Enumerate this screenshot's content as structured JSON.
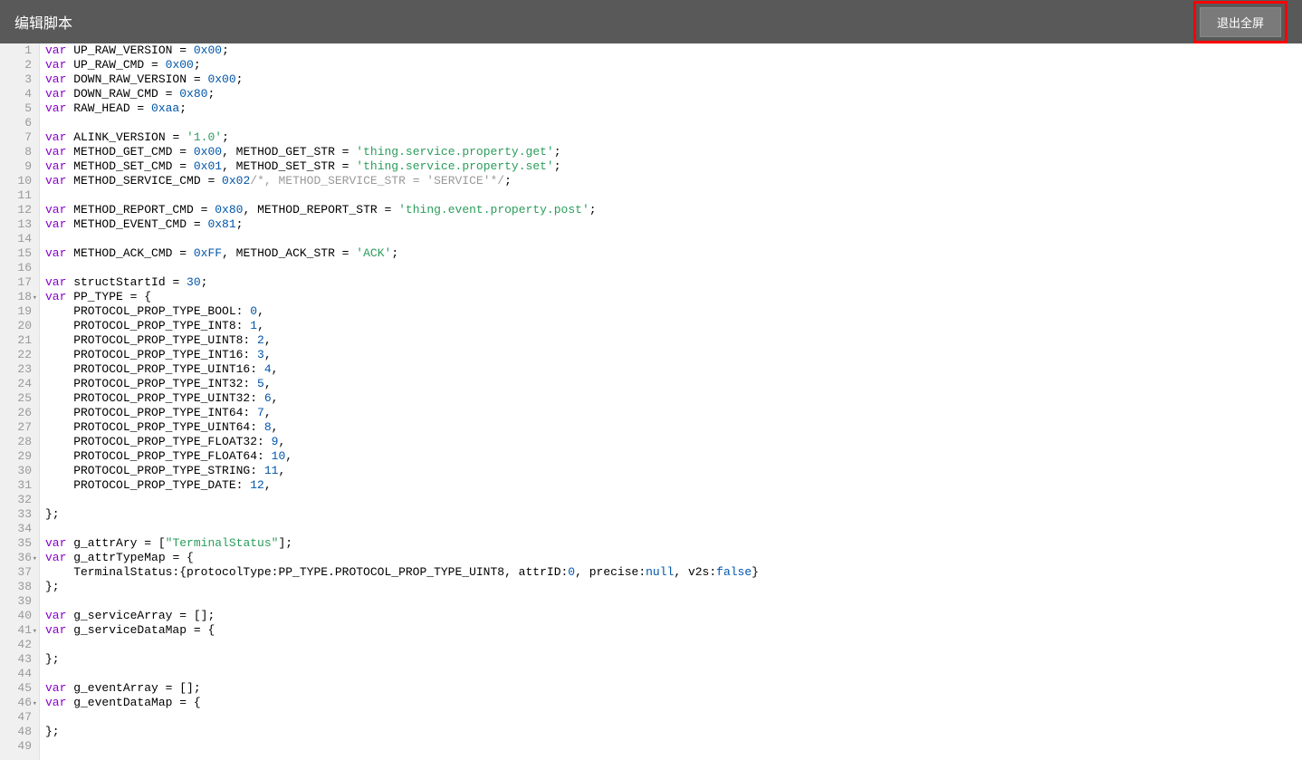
{
  "header": {
    "title": "编辑脚本",
    "exit_button": "退出全屏"
  },
  "editor": {
    "first_line": 1,
    "fold_lines": [
      18,
      36,
      41,
      46
    ],
    "lines": [
      {
        "n": 1,
        "tokens": [
          [
            "kw",
            "var"
          ],
          [
            "ident",
            " UP_RAW_VERSION "
          ],
          [
            "punct",
            "= "
          ],
          [
            "num",
            "0x00"
          ],
          [
            "punct",
            ";"
          ]
        ]
      },
      {
        "n": 2,
        "tokens": [
          [
            "kw",
            "var"
          ],
          [
            "ident",
            " UP_RAW_CMD "
          ],
          [
            "punct",
            "= "
          ],
          [
            "num",
            "0x00"
          ],
          [
            "punct",
            ";"
          ]
        ]
      },
      {
        "n": 3,
        "tokens": [
          [
            "kw",
            "var"
          ],
          [
            "ident",
            " DOWN_RAW_VERSION "
          ],
          [
            "punct",
            "= "
          ],
          [
            "num",
            "0x00"
          ],
          [
            "punct",
            ";"
          ]
        ]
      },
      {
        "n": 4,
        "tokens": [
          [
            "kw",
            "var"
          ],
          [
            "ident",
            " DOWN_RAW_CMD "
          ],
          [
            "punct",
            "= "
          ],
          [
            "num",
            "0x80"
          ],
          [
            "punct",
            ";"
          ]
        ]
      },
      {
        "n": 5,
        "tokens": [
          [
            "kw",
            "var"
          ],
          [
            "ident",
            " RAW_HEAD "
          ],
          [
            "punct",
            "= "
          ],
          [
            "num",
            "0xaa"
          ],
          [
            "punct",
            ";"
          ]
        ]
      },
      {
        "n": 6,
        "tokens": []
      },
      {
        "n": 7,
        "tokens": [
          [
            "kw",
            "var"
          ],
          [
            "ident",
            " ALINK_VERSION "
          ],
          [
            "punct",
            "= "
          ],
          [
            "str",
            "'1.0'"
          ],
          [
            "punct",
            ";"
          ]
        ]
      },
      {
        "n": 8,
        "tokens": [
          [
            "kw",
            "var"
          ],
          [
            "ident",
            " METHOD_GET_CMD "
          ],
          [
            "punct",
            "= "
          ],
          [
            "num",
            "0x00"
          ],
          [
            "punct",
            ", METHOD_GET_STR = "
          ],
          [
            "str",
            "'thing.service.property.get'"
          ],
          [
            "punct",
            ";"
          ]
        ]
      },
      {
        "n": 9,
        "tokens": [
          [
            "kw",
            "var"
          ],
          [
            "ident",
            " METHOD_SET_CMD "
          ],
          [
            "punct",
            "= "
          ],
          [
            "num",
            "0x01"
          ],
          [
            "punct",
            ", METHOD_SET_STR = "
          ],
          [
            "str",
            "'thing.service.property.set'"
          ],
          [
            "punct",
            ";"
          ]
        ]
      },
      {
        "n": 10,
        "tokens": [
          [
            "kw",
            "var"
          ],
          [
            "ident",
            " METHOD_SERVICE_CMD "
          ],
          [
            "punct",
            "= "
          ],
          [
            "num",
            "0x02"
          ],
          [
            "comment",
            "/*, METHOD_SERVICE_STR = 'SERVICE'*/"
          ],
          [
            "punct",
            ";"
          ]
        ]
      },
      {
        "n": 11,
        "tokens": []
      },
      {
        "n": 12,
        "tokens": [
          [
            "kw",
            "var"
          ],
          [
            "ident",
            " METHOD_REPORT_CMD "
          ],
          [
            "punct",
            "= "
          ],
          [
            "num",
            "0x80"
          ],
          [
            "punct",
            ", METHOD_REPORT_STR = "
          ],
          [
            "str",
            "'thing.event.property.post'"
          ],
          [
            "punct",
            ";"
          ]
        ]
      },
      {
        "n": 13,
        "tokens": [
          [
            "kw",
            "var"
          ],
          [
            "ident",
            " METHOD_EVENT_CMD "
          ],
          [
            "punct",
            "= "
          ],
          [
            "num",
            "0x81"
          ],
          [
            "punct",
            ";"
          ]
        ]
      },
      {
        "n": 14,
        "tokens": []
      },
      {
        "n": 15,
        "tokens": [
          [
            "kw",
            "var"
          ],
          [
            "ident",
            " METHOD_ACK_CMD "
          ],
          [
            "punct",
            "= "
          ],
          [
            "num",
            "0xFF"
          ],
          [
            "punct",
            ", METHOD_ACK_STR = "
          ],
          [
            "str",
            "'ACK'"
          ],
          [
            "punct",
            ";"
          ]
        ]
      },
      {
        "n": 16,
        "tokens": []
      },
      {
        "n": 17,
        "tokens": [
          [
            "kw",
            "var"
          ],
          [
            "ident",
            " structStartId "
          ],
          [
            "punct",
            "= "
          ],
          [
            "num",
            "30"
          ],
          [
            "punct",
            ";"
          ]
        ]
      },
      {
        "n": 18,
        "tokens": [
          [
            "kw",
            "var"
          ],
          [
            "ident",
            " PP_TYPE "
          ],
          [
            "punct",
            "= {"
          ]
        ]
      },
      {
        "n": 19,
        "tokens": [
          [
            "ident",
            "    PROTOCOL_PROP_TYPE_BOOL: "
          ],
          [
            "num",
            "0"
          ],
          [
            "punct",
            ","
          ]
        ]
      },
      {
        "n": 20,
        "tokens": [
          [
            "ident",
            "    PROTOCOL_PROP_TYPE_INT8: "
          ],
          [
            "num",
            "1"
          ],
          [
            "punct",
            ","
          ]
        ]
      },
      {
        "n": 21,
        "tokens": [
          [
            "ident",
            "    PROTOCOL_PROP_TYPE_UINT8: "
          ],
          [
            "num",
            "2"
          ],
          [
            "punct",
            ","
          ]
        ]
      },
      {
        "n": 22,
        "tokens": [
          [
            "ident",
            "    PROTOCOL_PROP_TYPE_INT16: "
          ],
          [
            "num",
            "3"
          ],
          [
            "punct",
            ","
          ]
        ]
      },
      {
        "n": 23,
        "tokens": [
          [
            "ident",
            "    PROTOCOL_PROP_TYPE_UINT16: "
          ],
          [
            "num",
            "4"
          ],
          [
            "punct",
            ","
          ]
        ]
      },
      {
        "n": 24,
        "tokens": [
          [
            "ident",
            "    PROTOCOL_PROP_TYPE_INT32: "
          ],
          [
            "num",
            "5"
          ],
          [
            "punct",
            ","
          ]
        ]
      },
      {
        "n": 25,
        "tokens": [
          [
            "ident",
            "    PROTOCOL_PROP_TYPE_UINT32: "
          ],
          [
            "num",
            "6"
          ],
          [
            "punct",
            ","
          ]
        ]
      },
      {
        "n": 26,
        "tokens": [
          [
            "ident",
            "    PROTOCOL_PROP_TYPE_INT64: "
          ],
          [
            "num",
            "7"
          ],
          [
            "punct",
            ","
          ]
        ]
      },
      {
        "n": 27,
        "tokens": [
          [
            "ident",
            "    PROTOCOL_PROP_TYPE_UINT64: "
          ],
          [
            "num",
            "8"
          ],
          [
            "punct",
            ","
          ]
        ]
      },
      {
        "n": 28,
        "tokens": [
          [
            "ident",
            "    PROTOCOL_PROP_TYPE_FLOAT32: "
          ],
          [
            "num",
            "9"
          ],
          [
            "punct",
            ","
          ]
        ]
      },
      {
        "n": 29,
        "tokens": [
          [
            "ident",
            "    PROTOCOL_PROP_TYPE_FLOAT64: "
          ],
          [
            "num",
            "10"
          ],
          [
            "punct",
            ","
          ]
        ]
      },
      {
        "n": 30,
        "tokens": [
          [
            "ident",
            "    PROTOCOL_PROP_TYPE_STRING: "
          ],
          [
            "num",
            "11"
          ],
          [
            "punct",
            ","
          ]
        ]
      },
      {
        "n": 31,
        "tokens": [
          [
            "ident",
            "    PROTOCOL_PROP_TYPE_DATE: "
          ],
          [
            "num",
            "12"
          ],
          [
            "punct",
            ","
          ]
        ]
      },
      {
        "n": 32,
        "tokens": []
      },
      {
        "n": 33,
        "tokens": [
          [
            "punct",
            "};"
          ]
        ]
      },
      {
        "n": 34,
        "tokens": []
      },
      {
        "n": 35,
        "tokens": [
          [
            "kw",
            "var"
          ],
          [
            "ident",
            " g_attrAry "
          ],
          [
            "punct",
            "= ["
          ],
          [
            "str",
            "\"TerminalStatus\""
          ],
          [
            "punct",
            "];"
          ]
        ]
      },
      {
        "n": 36,
        "tokens": [
          [
            "kw",
            "var"
          ],
          [
            "ident",
            " g_attrTypeMap "
          ],
          [
            "punct",
            "= {"
          ]
        ]
      },
      {
        "n": 37,
        "tokens": [
          [
            "ident",
            "    TerminalStatus:{protocolType:PP_TYPE.PROTOCOL_PROP_TYPE_UINT8, attrID:"
          ],
          [
            "num",
            "0"
          ],
          [
            "punct",
            ", precise:"
          ],
          [
            "num",
            "null"
          ],
          [
            "punct",
            ", v2s:"
          ],
          [
            "num",
            "false"
          ],
          [
            "punct",
            "}"
          ]
        ]
      },
      {
        "n": 38,
        "tokens": [
          [
            "punct",
            "};"
          ]
        ]
      },
      {
        "n": 39,
        "tokens": []
      },
      {
        "n": 40,
        "tokens": [
          [
            "kw",
            "var"
          ],
          [
            "ident",
            " g_serviceArray "
          ],
          [
            "punct",
            "= [];"
          ]
        ]
      },
      {
        "n": 41,
        "tokens": [
          [
            "kw",
            "var"
          ],
          [
            "ident",
            " g_serviceDataMap "
          ],
          [
            "punct",
            "= {"
          ]
        ]
      },
      {
        "n": 42,
        "tokens": []
      },
      {
        "n": 43,
        "tokens": [
          [
            "punct",
            "};"
          ]
        ]
      },
      {
        "n": 44,
        "tokens": []
      },
      {
        "n": 45,
        "tokens": [
          [
            "kw",
            "var"
          ],
          [
            "ident",
            " g_eventArray "
          ],
          [
            "punct",
            "= [];"
          ]
        ]
      },
      {
        "n": 46,
        "tokens": [
          [
            "kw",
            "var"
          ],
          [
            "ident",
            " g_eventDataMap "
          ],
          [
            "punct",
            "= {"
          ]
        ]
      },
      {
        "n": 47,
        "tokens": []
      },
      {
        "n": 48,
        "tokens": [
          [
            "punct",
            "};"
          ]
        ]
      },
      {
        "n": 49,
        "tokens": []
      }
    ]
  }
}
